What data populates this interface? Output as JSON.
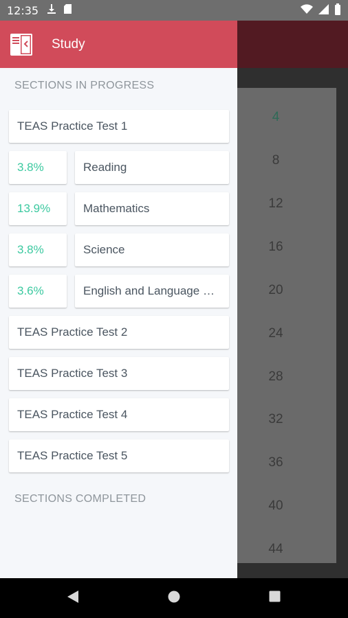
{
  "status_bar": {
    "time": "12:35",
    "icons_left": [
      "download-icon",
      "sd-card-icon"
    ],
    "icons_right": [
      "wifi-icon",
      "signal-icon",
      "battery-icon"
    ]
  },
  "drawer": {
    "title": "Study",
    "section_in_progress": "SECTIONS IN PROGRESS",
    "section_completed": "SECTIONS COMPLETED",
    "tests": [
      {
        "name": "TEAS Practice Test 1",
        "sections": [
          {
            "percent": "3.8%",
            "name": "Reading"
          },
          {
            "percent": "13.9%",
            "name": "Mathematics"
          },
          {
            "percent": "3.8%",
            "name": "Science"
          },
          {
            "percent": "3.6%",
            "name": "English and Language Usage"
          }
        ]
      },
      {
        "name": "TEAS Practice Test 2"
      },
      {
        "name": "TEAS Practice Test 3"
      },
      {
        "name": "TEAS Practice Test 4"
      },
      {
        "name": "TEAS Practice Test 5"
      }
    ]
  },
  "background": {
    "numbers": [
      "4",
      "8",
      "12",
      "16",
      "20",
      "24",
      "28",
      "32",
      "36",
      "40",
      "44"
    ]
  },
  "colors": {
    "header": "#d14b5a",
    "percent": "#3cc9a0"
  }
}
